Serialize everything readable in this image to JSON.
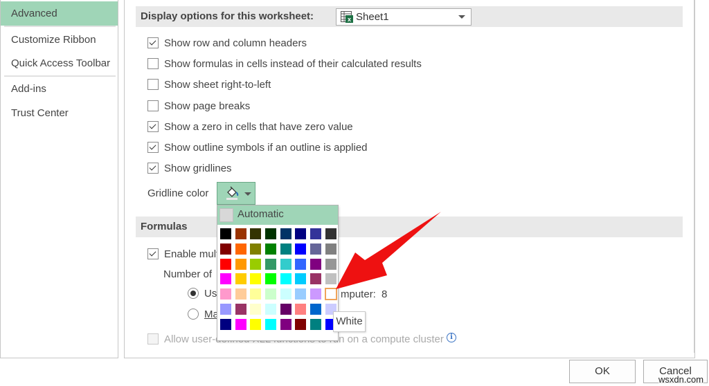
{
  "nav": {
    "items": [
      {
        "label": "Advanced",
        "selected": true
      },
      {
        "label": "Customize Ribbon",
        "selected": false
      },
      {
        "label": "Quick Access Toolbar",
        "selected": false
      },
      {
        "label": "Add-ins",
        "selected": false
      },
      {
        "label": "Trust Center",
        "selected": false
      }
    ]
  },
  "display_section": {
    "header": "Display options for this worksheet:",
    "sheet_select": {
      "value": "Sheet1",
      "icon": "excel-sheet-icon"
    },
    "options": [
      {
        "label": "Show row and column headers",
        "checked": true
      },
      {
        "label": "Show formulas in cells instead of their calculated results",
        "checked": false
      },
      {
        "label": "Show sheet right-to-left",
        "checked": false
      },
      {
        "label": "Show page breaks",
        "checked": false
      },
      {
        "label": "Show a zero in cells that have zero value",
        "checked": true
      },
      {
        "label": "Show outline symbols if an outline is applied",
        "checked": true
      },
      {
        "label": "Show gridlines",
        "checked": true
      }
    ],
    "gridline_color_label": "Gridline color",
    "gridline_color_icon": "paint-bucket-icon"
  },
  "formulas_section": {
    "header": "Formulas",
    "enable_multithreaded": {
      "label": "Enable mult",
      "checked": true
    },
    "number_of_threads_label": "Number of",
    "use_all_processors": {
      "label_start": "Us",
      "label_end": "mputer:",
      "value": "8",
      "selected": true
    },
    "manual": {
      "label": "Ma",
      "selected": false
    },
    "allow_xll": {
      "label": "Allow user-defined XLL functions to run on a compute cluster",
      "checked": false,
      "disabled": true
    }
  },
  "color_palette": {
    "automatic_label": "Automatic",
    "hovered_color_name": "White",
    "colors": [
      "#000000",
      "#993300",
      "#333300",
      "#003300",
      "#003366",
      "#000080",
      "#333399",
      "#333333",
      "#800000",
      "#FF6600",
      "#808000",
      "#008000",
      "#008080",
      "#0000FF",
      "#666699",
      "#808080",
      "#FF0000",
      "#FF9900",
      "#99CC00",
      "#339966",
      "#33CCCC",
      "#3366FF",
      "#800080",
      "#969696",
      "#FF00FF",
      "#FFCC00",
      "#FFFF00",
      "#00FF00",
      "#00FFFF",
      "#00CCFF",
      "#993366",
      "#C0C0C0",
      "#FF99CC",
      "#FFCC99",
      "#FFFF99",
      "#CCFFCC",
      "#CCFFFF",
      "#99CCFF",
      "#CC99FF",
      "#FFFFFF",
      "#9999FF",
      "#993366",
      "#FFFFCC",
      "#CCFFFF",
      "#660066",
      "#FF8080",
      "#0066CC",
      "#CCCCFF",
      "#000080",
      "#FF00FF",
      "#FFFF00",
      "#00FFFF",
      "#800080",
      "#800000",
      "#008080",
      "#0000FF"
    ],
    "hovered_index": 39
  },
  "footer": {
    "ok_label": "OK",
    "cancel_label": "Cancel"
  },
  "watermark": "wsxdn.com",
  "colors": {
    "accent": "#9fd5b7",
    "annotation_arrow": "#ee1111"
  }
}
